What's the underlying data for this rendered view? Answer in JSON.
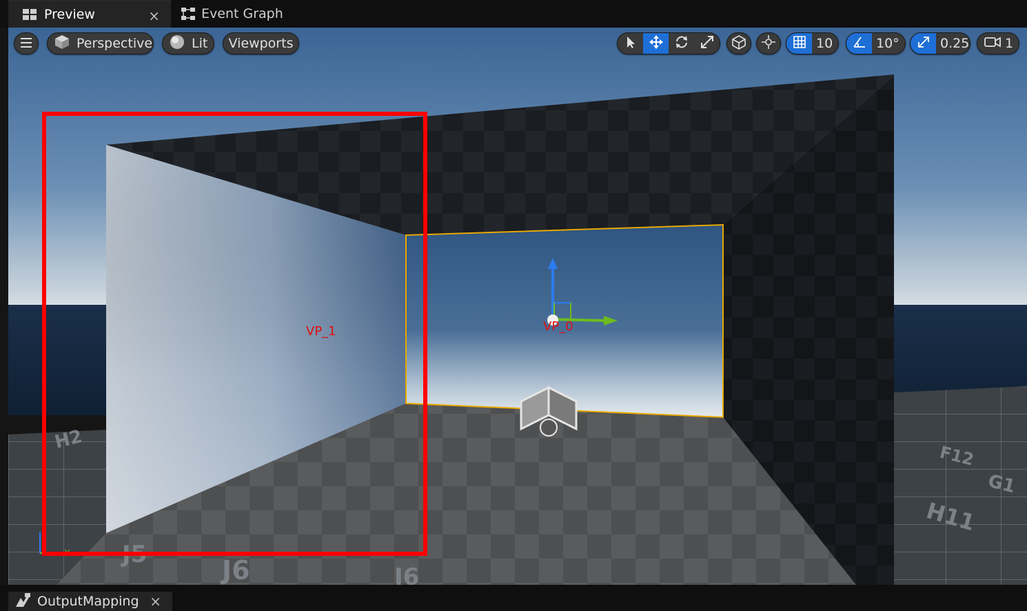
{
  "tabs": [
    {
      "label": "Preview",
      "icon": "grid-layout-icon",
      "active": true,
      "closable": true
    },
    {
      "label": "Event Graph",
      "icon": "graph-nodes-icon",
      "active": false,
      "closable": false
    }
  ],
  "toolbar": {
    "menu_icon": "hamburger-menu-icon",
    "perspective_label": "Perspective",
    "lit_label": "Lit",
    "viewports_label": "Viewports",
    "grid_snap_value": "10",
    "rotation_snap_value": "10°",
    "scale_snap_value": "0.25",
    "camera_speed_value": "1",
    "accent_color": "#1e6fd6"
  },
  "viewport": {
    "labels": {
      "vp1": "VP_1",
      "vp0": "VP_0"
    },
    "floor_tiles": [
      "J6",
      "I6",
      "F12",
      "G1",
      "H11",
      "H2",
      "J5"
    ],
    "selection_color": "#ff0000",
    "selected_outline_color": "#e8a800"
  },
  "bottom_tab": {
    "label": "OutputMapping",
    "icon": "output-mapping-icon",
    "closable": true
  }
}
